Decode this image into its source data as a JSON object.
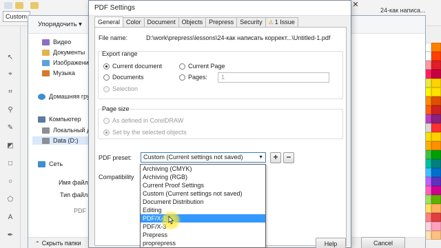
{
  "background": {
    "custom_box": "Custom",
    "right_title": "24-как написа...",
    "close_glyph": "✕"
  },
  "save_dialog": {
    "organize_label": "Упорядочить ▾",
    "nav": [
      {
        "label": "Видео",
        "icon": "video-library-icon",
        "color": "#8b6fc7"
      },
      {
        "label": "Документы",
        "icon": "documents-library-icon",
        "color": "#e0b54a"
      },
      {
        "label": "Изображения",
        "icon": "pictures-library-icon",
        "color": "#5aa3d6"
      },
      {
        "label": "Музыка",
        "icon": "music-library-icon",
        "color": "#d47a2e"
      },
      {
        "label": "Домашняя группа",
        "icon": "homegroup-icon",
        "color": "#3e8ed0"
      },
      {
        "label": "Компьютер",
        "icon": "computer-icon",
        "color": "#5b7aa0"
      },
      {
        "label": "Локальный диск",
        "icon": "local-disk-icon",
        "color": "#8a8f96"
      },
      {
        "label": "Data (D:)",
        "icon": "data-disk-icon",
        "color": "#8a8f96"
      },
      {
        "label": "Сеть",
        "icon": "network-icon",
        "color": "#3e8ed0"
      }
    ],
    "filename_label": "Имя файла:",
    "filetype_label": "Тип файла:",
    "pdf_label": "PDF p",
    "hide_folders": "Скрыть папки"
  },
  "pdf_dialog": {
    "title": "PDF Settings",
    "tabs": [
      "General",
      "Color",
      "Document",
      "Objects",
      "Prepress",
      "Security",
      "1 Issue"
    ],
    "file_name_label": "File name:",
    "file_name_value": "D:\\work\\prepress\\lessons\\24-как написать коррект...\\Untitled-1.pdf",
    "export_range": {
      "title": "Export range",
      "current_document": "Current document",
      "documents": "Documents",
      "selection": "Selection",
      "current_page": "Current Page",
      "pages": "Pages:",
      "pages_value": "1"
    },
    "page_size": {
      "title": "Page size",
      "as_defined": "As defined in CorelDRAW",
      "set_by_selected": "Set by the selected objects"
    },
    "pdf_preset_label": "PDF preset:",
    "pdf_preset_value": "Custom (Current settings not saved)",
    "compatibility_label": "Compatibility",
    "preset_options": [
      "Archiving (CMYK)",
      "Archiving (RGB)",
      "Current Proof Settings",
      "Custom (Current settings not saved)",
      "Document Distribution",
      "Editing",
      "PDF/X-1",
      "PDF/X-3",
      "Prepress",
      "proprepress"
    ],
    "highlighted_option_index": 6,
    "help_label": "Help",
    "cancel_label": "Cancel"
  }
}
